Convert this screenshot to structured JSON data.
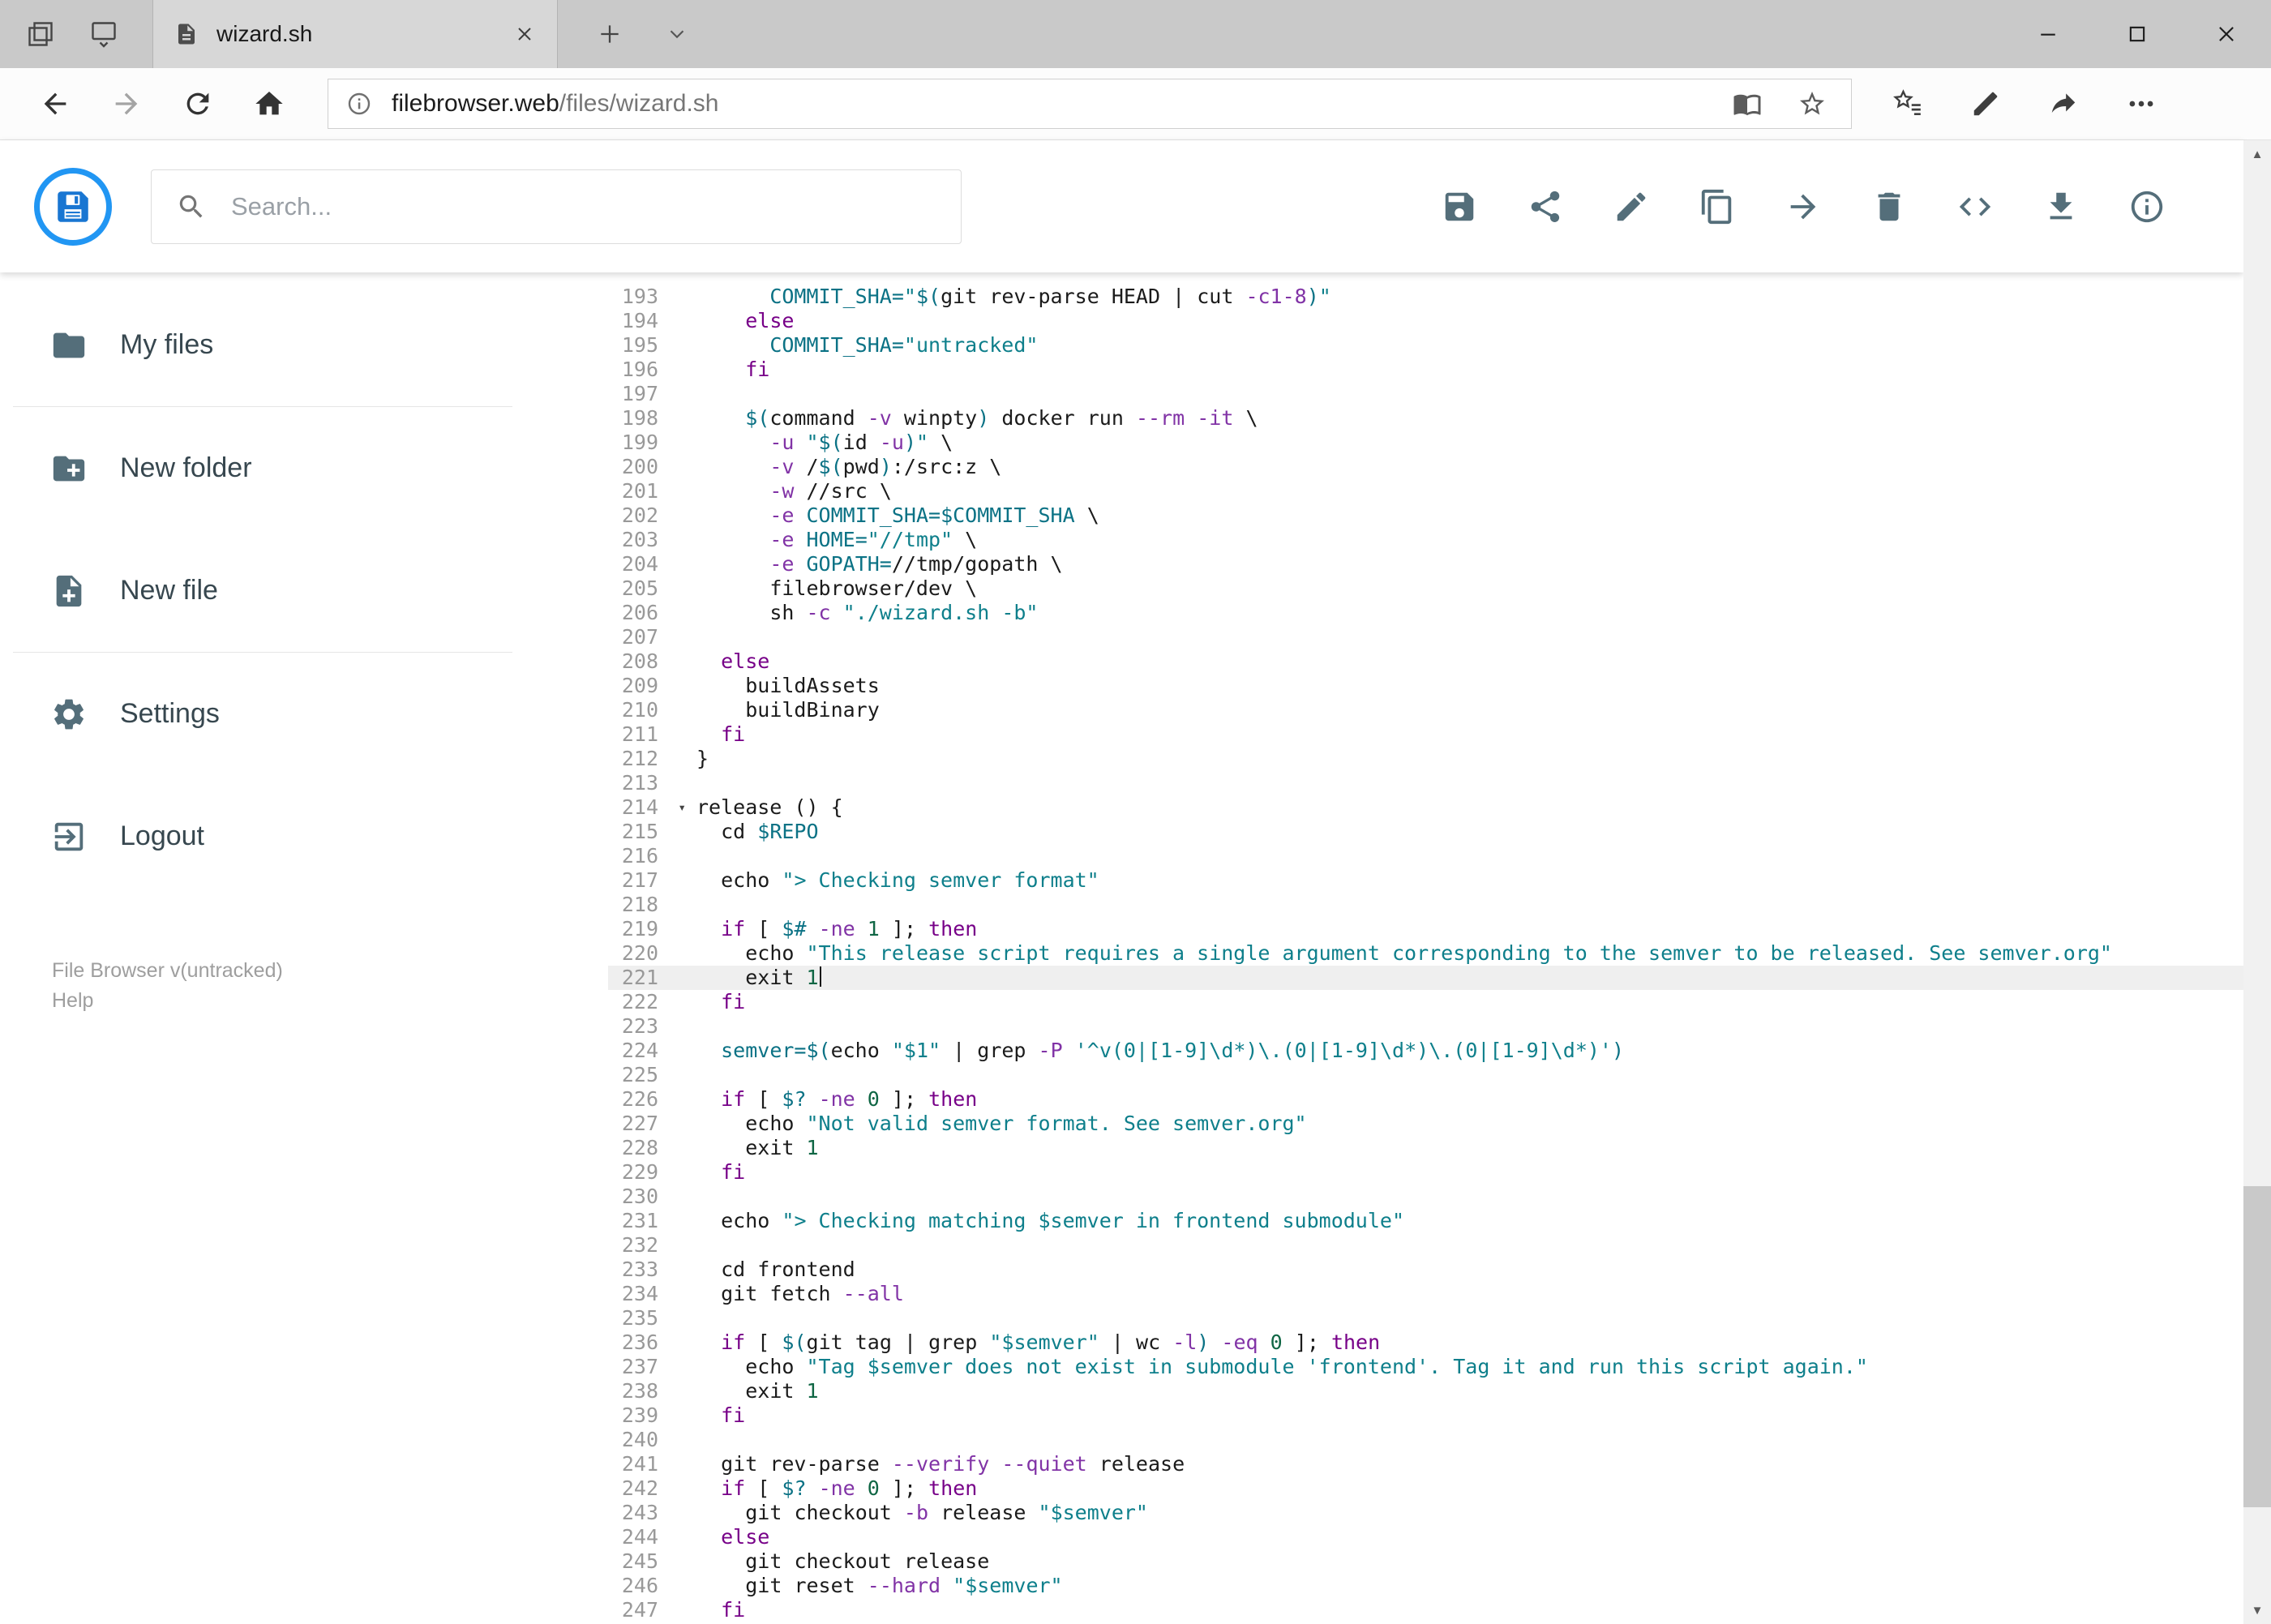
{
  "browser": {
    "tab_title": "wizard.sh",
    "url_host": "filebrowser.web",
    "url_path": "/files/wizard.sh",
    "nav_icons": [
      "back-icon",
      "forward-icon",
      "refresh-icon",
      "home-icon"
    ],
    "urlbar_icons": [
      "info-icon",
      "reading-view-icon",
      "favorite-star-icon"
    ],
    "toolbar_icons": [
      "hub-icon",
      "web-note-icon",
      "share-icon",
      "more-icon"
    ],
    "window_controls": [
      "minimize-icon",
      "maximize-icon",
      "close-icon"
    ]
  },
  "app": {
    "search_placeholder": "Search...",
    "accent_color": "#2196f3",
    "toolbar_icons": [
      "save-icon",
      "share-icon",
      "rename-icon",
      "copy-icon",
      "move-icon",
      "delete-icon",
      "source-view-icon",
      "download-icon",
      "info-icon"
    ],
    "sidebar": {
      "items": [
        {
          "label": "My files",
          "icon": "folder-icon"
        },
        {
          "label": "New folder",
          "icon": "new-folder-icon"
        },
        {
          "label": "New file",
          "icon": "new-file-icon"
        },
        {
          "label": "Settings",
          "icon": "settings-icon"
        },
        {
          "label": "Logout",
          "icon": "logout-icon"
        }
      ],
      "version": "File Browser v(untracked)",
      "help": "Help"
    }
  },
  "editor": {
    "language": "shell",
    "first_line": 193,
    "active_line": 221,
    "cursor_line": 221,
    "fold_markers": [
      214
    ],
    "keywords": [
      "if",
      "then",
      "else",
      "fi",
      "for",
      "while",
      "do",
      "done",
      "case",
      "esac"
    ],
    "token_colors": {
      "p": "#1b1b1b",
      "k": "#770088",
      "s": "#0e7f8b",
      "v": "#0b7285",
      "a": "#8133a6",
      "n": "#0f6644"
    },
    "active_line_color": "#efefef",
    "line_number_color": "#999999",
    "lines": [
      "      COMMIT_SHA=\"$(git rev-parse HEAD | cut -c1-8)\"",
      "    else",
      "      COMMIT_SHA=\"untracked\"",
      "    fi",
      "",
      "    $(command -v winpty) docker run --rm -it \\",
      "      -u \"$(id -u)\" \\",
      "      -v /$(pwd):/src:z \\",
      "      -w //src \\",
      "      -e COMMIT_SHA=$COMMIT_SHA \\",
      "      -e HOME=\"//tmp\" \\",
      "      -e GOPATH=//tmp/gopath \\",
      "      filebrowser/dev \\",
      "      sh -c \"./wizard.sh -b\"",
      "",
      "  else",
      "    buildAssets",
      "    buildBinary",
      "  fi",
      "}",
      "",
      "release () {",
      "  cd $REPO",
      "",
      "  echo \"> Checking semver format\"",
      "",
      "  if [ $# -ne 1 ]; then",
      "    echo \"This release script requires a single argument corresponding to the semver to be released. See semver.org\"",
      "    exit 1",
      "  fi",
      "",
      "  semver=$(echo \"$1\" | grep -P '^v(0|[1-9]\\d*)\\.(0|[1-9]\\d*)\\.(0|[1-9]\\d*)')",
      "",
      "  if [ $? -ne 0 ]; then",
      "    echo \"Not valid semver format. See semver.org\"",
      "    exit 1",
      "  fi",
      "",
      "  echo \"> Checking matching $semver in frontend submodule\"",
      "",
      "  cd frontend",
      "  git fetch --all",
      "",
      "  if [ $(git tag | grep \"$semver\" | wc -l) -eq 0 ]; then",
      "    echo \"Tag $semver does not exist in submodule 'frontend'. Tag it and run this script again.\"",
      "    exit 1",
      "  fi",
      "",
      "  git rev-parse --verify --quiet release",
      "  if [ $? -ne 0 ]; then",
      "    git checkout -b release \"$semver\"",
      "  else",
      "    git checkout release",
      "    git reset --hard \"$semver\"",
      "  fi"
    ]
  }
}
